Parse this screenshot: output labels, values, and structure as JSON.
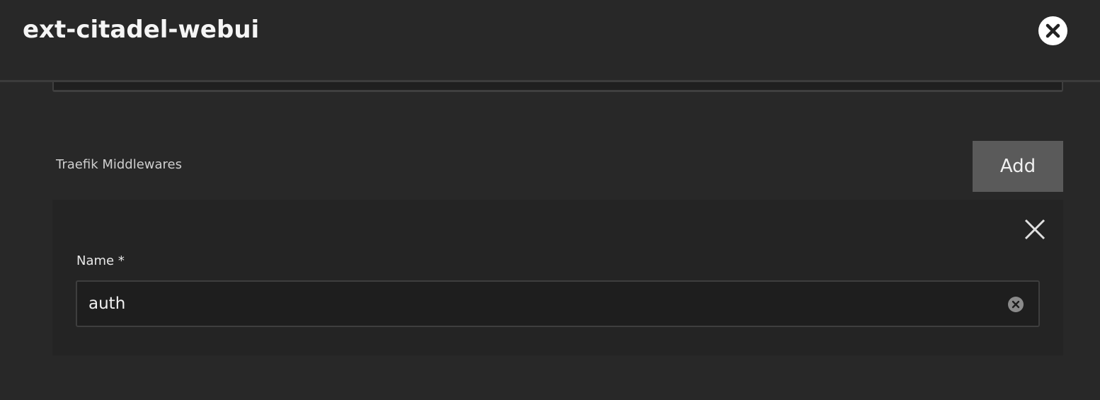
{
  "dialog": {
    "title": "ext-citadel-webui",
    "close_icon": "close-circle-icon"
  },
  "middlewares": {
    "section_label": "Traefik Middlewares",
    "add_label": "Add",
    "items": [
      {
        "remove_icon": "close-icon",
        "name_label": "Name *",
        "name_value": "auth",
        "clear_icon": "clear-circle-icon"
      }
    ]
  },
  "colors": {
    "background": "#282828",
    "card_background": "#242424",
    "input_background": "#1e1e1e",
    "button_background": "#5a5a5a",
    "text": "#f0f0f0"
  }
}
